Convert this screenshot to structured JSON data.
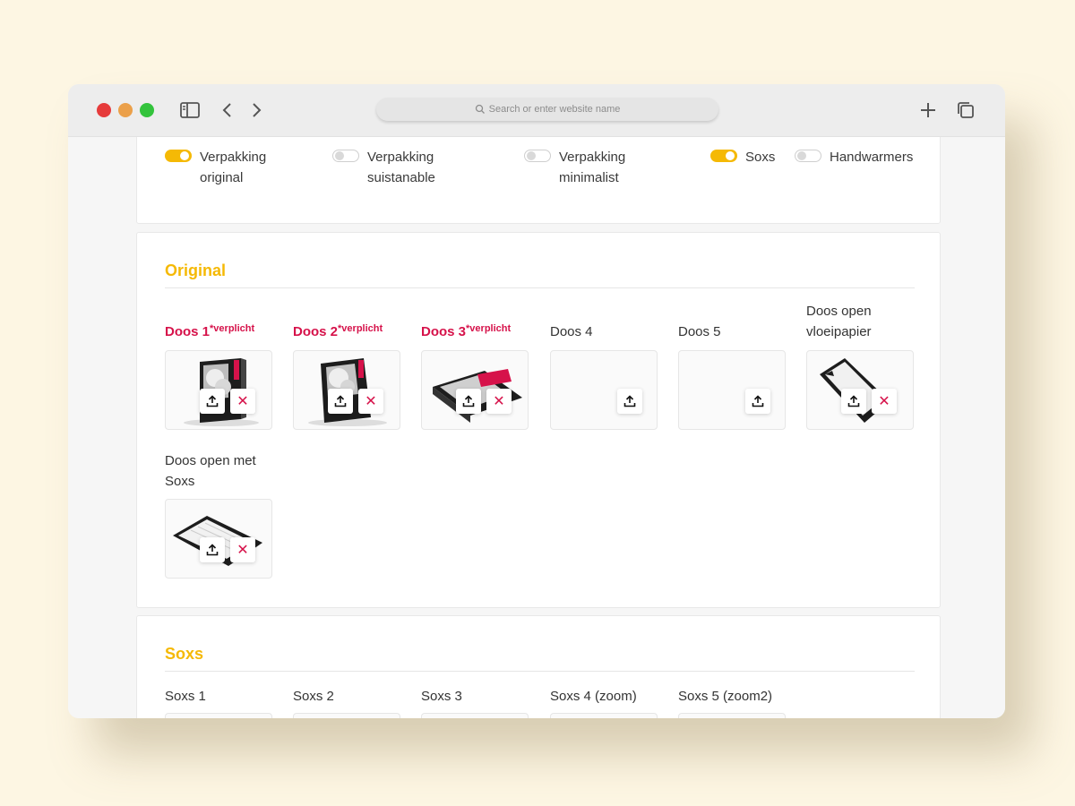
{
  "browser": {
    "address_placeholder": "Search or enter website name"
  },
  "options": [
    {
      "label": "Verpakking original",
      "on": true
    },
    {
      "label": "Verpakking suistanable",
      "on": false
    },
    {
      "label": "Verpakking minimalist",
      "on": false
    },
    {
      "label": "Soxs",
      "on": true
    },
    {
      "label": "Handwarmers",
      "on": false
    }
  ],
  "original": {
    "title": "Original",
    "tiles": [
      {
        "label": "Doos 1",
        "required_note": "*verplicht"
      },
      {
        "label": "Doos 2",
        "required_note": "*verplicht"
      },
      {
        "label": "Doos 3",
        "required_note": "*verplicht"
      },
      {
        "label": "Doos 4"
      },
      {
        "label": "Doos 5"
      },
      {
        "label": "Doos open vloeipapier"
      },
      {
        "label": "Doos open met Soxs"
      }
    ]
  },
  "soxs": {
    "title": "Soxs",
    "tiles": [
      {
        "label": "Soxs 1"
      },
      {
        "label": "Soxs 2"
      },
      {
        "label": "Soxs 3"
      },
      {
        "label": "Soxs 4 (zoom)"
      },
      {
        "label": "Soxs 5 (zoom2)"
      }
    ]
  },
  "colors": {
    "accent": "#f5b905",
    "required": "#d6124a"
  }
}
